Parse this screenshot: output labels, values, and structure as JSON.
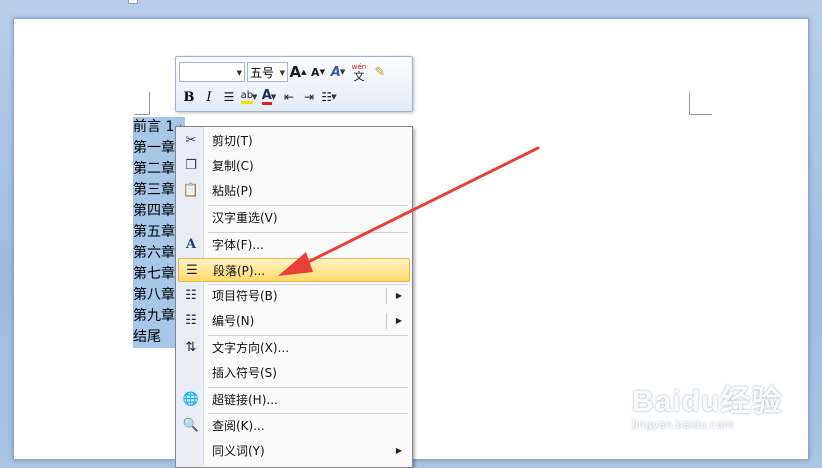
{
  "document": {
    "lines": [
      "前言 1",
      "第一章",
      "第二章",
      "第三章",
      "第四章",
      "第五章",
      "第六章",
      "第七章",
      "第八章",
      "第九章",
      "结尾"
    ],
    "paragraph_mark": "↵"
  },
  "mini_toolbar": {
    "font_name": "",
    "font_size": "五号",
    "grow_font": "A",
    "shrink_font": "A",
    "bold": "B",
    "italic": "I",
    "font_color_glyph": "A",
    "highlight_glyph": "ab",
    "phonetic_label": "wén"
  },
  "context_menu": {
    "items": [
      {
        "label": "剪切(T)",
        "icon": "scissors-icon"
      },
      {
        "label": "复制(C)",
        "icon": "copy-icon"
      },
      {
        "label": "粘贴(P)",
        "icon": "paste-icon"
      },
      {
        "label": "汉字重选(V)",
        "icon": ""
      },
      {
        "label": "字体(F)...",
        "icon": "font-icon"
      },
      {
        "label": "段落(P)...",
        "icon": "paragraph-icon"
      },
      {
        "label": "项目符号(B)",
        "icon": "bullets-icon"
      },
      {
        "label": "编号(N)",
        "icon": "numbering-icon"
      },
      {
        "label": "文字方向(X)...",
        "icon": "text-direction-icon"
      },
      {
        "label": "插入符号(S)",
        "icon": ""
      },
      {
        "label": "超链接(H)...",
        "icon": "hyperlink-icon"
      },
      {
        "label": "查阅(K)...",
        "icon": "research-icon"
      },
      {
        "label": "同义词(Y)",
        "icon": ""
      }
    ],
    "highlighted_index": 5
  },
  "watermark": {
    "brand": "Baidu经验",
    "url": "jingyan.baidu.com"
  },
  "colors": {
    "selection": "#a7c6e8",
    "arrow": "#e8403a",
    "highlight_yellow": "#f6e400",
    "font_red": "#e02020"
  }
}
